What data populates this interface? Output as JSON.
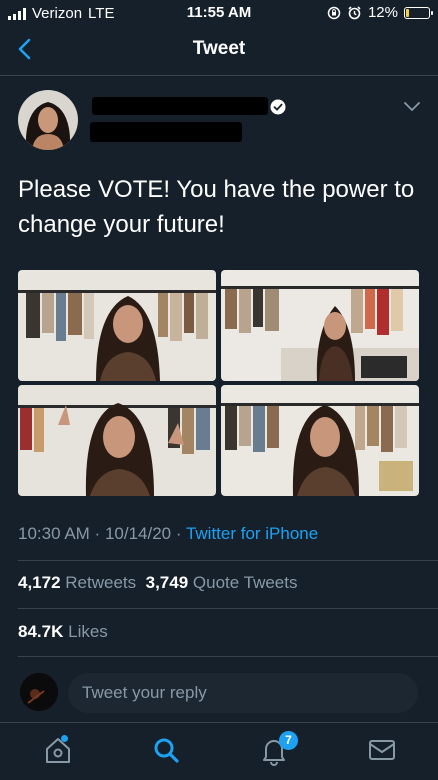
{
  "status_bar": {
    "carrier": "Verizon",
    "network": "LTE",
    "time": "11:55 AM",
    "battery": "12%",
    "battery_level": 0.12
  },
  "header": {
    "title": "Tweet"
  },
  "tweet": {
    "text": "Please VOTE! You have the power to change your future!",
    "meta": {
      "time": "10:30 AM",
      "sep1": " · ",
      "date": "10/14/20",
      "sep2": " · ",
      "app": "Twitter for iPhone"
    },
    "stats": {
      "retweets_count": "4,172",
      "retweets_label": "Retweets",
      "quotes_count": "3,749",
      "quotes_label": "Quote Tweets",
      "likes_count": "84.7K",
      "likes_label": "Likes"
    }
  },
  "reply": {
    "placeholder": "Tweet your reply"
  },
  "tab_bar": {
    "notifications_badge": "7",
    "icons": [
      "home-icon",
      "search-icon",
      "notifications-icon",
      "messages-icon"
    ]
  },
  "colors": {
    "background": "#15202b",
    "accent": "#1da1f2",
    "secondary_text": "#8899a6",
    "divider": "#38444d"
  }
}
